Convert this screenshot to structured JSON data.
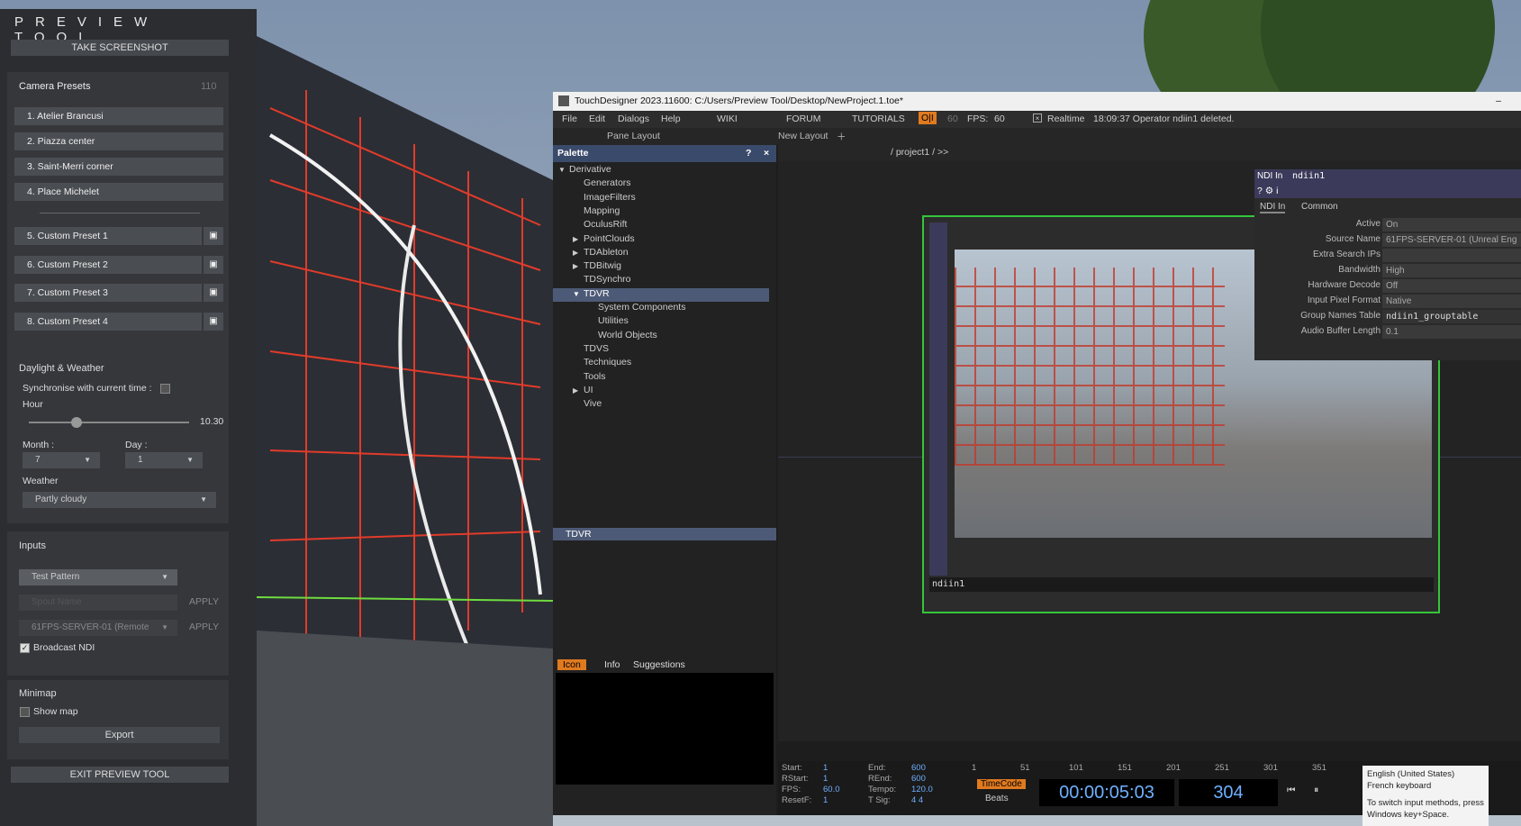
{
  "preview": {
    "title": "PREVIEW TOOL",
    "take_screenshot": "TAKE SCREENSHOT",
    "camera_presets": {
      "label": "Camera Presets",
      "count": "110",
      "items": [
        "1. Atelier Brancusi",
        "2. Piazza center",
        "3. Saint-Merri corner",
        "4. Place Michelet"
      ],
      "custom": [
        "5. Custom Preset 1",
        "6. Custom Preset 2",
        "7. Custom Preset 3",
        "8. Custom Preset 4"
      ]
    },
    "daylight": {
      "label": "Daylight & Weather",
      "sync_label": "Synchronise with current time :",
      "hour_label": "Hour",
      "hour_value": "10.30",
      "hour_fraction": 0.3,
      "month_label": "Month :",
      "month_value": "7",
      "day_label": "Day :",
      "day_value": "1",
      "weather_label": "Weather",
      "weather_value": "Partly cloudy"
    },
    "inputs": {
      "label": "Inputs",
      "source_select": "Test Pattern",
      "spout_placeholder": "Spout Name",
      "apply1": "APPLY",
      "ndi_select": "61FPS-SERVER-01 (Remote",
      "apply2": "APPLY",
      "broadcast_label": "Broadcast NDI",
      "broadcast_checked": true
    },
    "minimap": {
      "label": "Minimap",
      "show_map": "Show map",
      "export": "Export"
    },
    "exit": "EXIT PREVIEW TOOL"
  },
  "td": {
    "title": "TouchDesigner 2023.11600: C:/Users/Preview Tool/Desktop/NewProject.1.toe*",
    "menu": [
      "File",
      "Edit",
      "Dialogs",
      "Help",
      "WIKI",
      "FORUM",
      "TUTORIALS"
    ],
    "oi": "O|I",
    "fps_target": "60",
    "fps_label": "FPS:",
    "fps_value": "60",
    "realtime": "Realtime",
    "status": "18:09:37 Operator ndiin1 deleted.",
    "pane_layout": "Pane Layout",
    "new_layout": "New Layout",
    "path": "/ project1 / >>",
    "palette": {
      "title": "Palette",
      "help": "?",
      "close": "×",
      "items": [
        {
          "label": "Derivative",
          "level": 0,
          "arrow": "▼"
        },
        {
          "label": "Generators",
          "level": 1,
          "arrow": ""
        },
        {
          "label": "ImageFilters",
          "level": 1,
          "arrow": ""
        },
        {
          "label": "Mapping",
          "level": 1,
          "arrow": ""
        },
        {
          "label": "OculusRift",
          "level": 1,
          "arrow": ""
        },
        {
          "label": "PointClouds",
          "level": 1,
          "arrow": "▶"
        },
        {
          "label": "TDAbleton",
          "level": 1,
          "arrow": "▶"
        },
        {
          "label": "TDBitwig",
          "level": 1,
          "arrow": "▶"
        },
        {
          "label": "TDSynchro",
          "level": 1,
          "arrow": ""
        },
        {
          "label": "TDVR",
          "level": 1,
          "arrow": "▼",
          "selected": true
        },
        {
          "label": "System Components",
          "level": 2,
          "arrow": ""
        },
        {
          "label": "Utilities",
          "level": 2,
          "arrow": ""
        },
        {
          "label": "World Objects",
          "level": 2,
          "arrow": ""
        },
        {
          "label": "TDVS",
          "level": 1,
          "arrow": ""
        },
        {
          "label": "Techniques",
          "level": 1,
          "arrow": ""
        },
        {
          "label": "Tools",
          "level": 1,
          "arrow": ""
        },
        {
          "label": "UI",
          "level": 1,
          "arrow": "▶"
        },
        {
          "label": "Vive",
          "level": 1,
          "arrow": ""
        }
      ],
      "selected_bar": "TDVR",
      "tabs": [
        "Icon",
        "Info",
        "Suggestions"
      ]
    },
    "node_name": "ndiin1",
    "params": {
      "type": "NDI In",
      "name": "ndiin1",
      "tabs": [
        "NDI In",
        "Common"
      ],
      "rows": [
        {
          "k": "Active",
          "v": "On"
        },
        {
          "k": "Source Name",
          "v": "61FPS-SERVER-01 (Unreal Eng"
        },
        {
          "k": "Extra Search IPs",
          "v": ""
        },
        {
          "k": "Bandwidth",
          "v": "High"
        },
        {
          "k": "Hardware Decode",
          "v": "Off"
        },
        {
          "k": "Input Pixel Format",
          "v": "Native"
        },
        {
          "k": "Group Names Table",
          "v": "ndiin1_grouptable"
        },
        {
          "k": "Audio Buffer Length",
          "v": "0.1"
        }
      ]
    },
    "timeinfo": {
      "left": [
        [
          "Start:",
          "1"
        ],
        [
          "RStart:",
          "1"
        ],
        [
          "FPS:",
          "60.0"
        ],
        [
          "ResetF:",
          "1"
        ]
      ],
      "right": [
        [
          "End:",
          "600"
        ],
        [
          "REnd:",
          "600"
        ],
        [
          "Tempo:",
          "120.0"
        ],
        [
          "T Sig:",
          "4    4"
        ]
      ]
    },
    "ticks": [
      "1",
      "51",
      "101",
      "151",
      "201",
      "251",
      "301",
      "351"
    ],
    "timecode_label": "TimeCode",
    "beats_label": "Beats",
    "timecode": "00:00:05:03",
    "frame": "304",
    "range_label": "Range",
    "loop_label": "Loop"
  },
  "ime": {
    "line1": "English (United States)",
    "line2": "French keyboard",
    "line3": "To switch input methods, press",
    "line4": "Windows key+Space."
  }
}
